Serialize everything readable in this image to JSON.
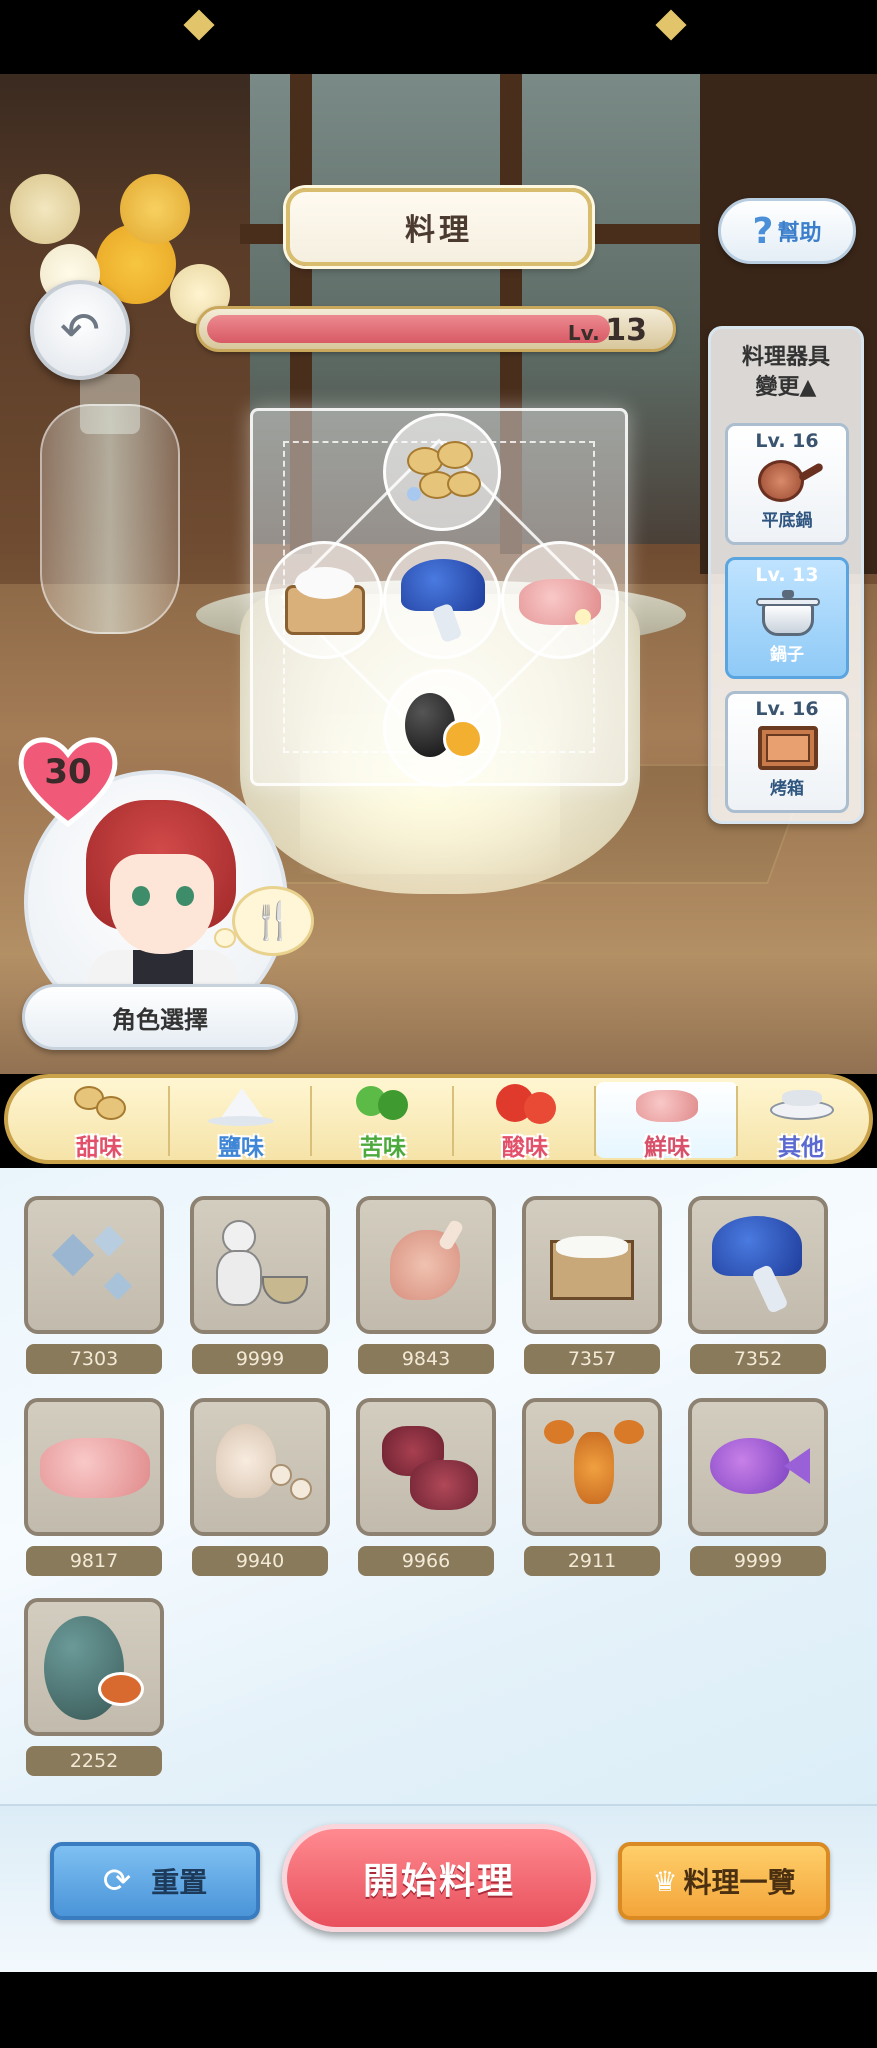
{
  "header": {
    "title": "料理",
    "help_icon": "?",
    "help_label": "幫助"
  },
  "back_icon": "↶",
  "level": {
    "prefix": "Lv.",
    "value": "13",
    "progress": 0.88
  },
  "board": {
    "slots": [
      "sweet-beans",
      "rice",
      "blue-mushroom",
      "pork-meat",
      "black-egg"
    ]
  },
  "tools": {
    "header": "料理器具\n變更▲",
    "items": [
      {
        "level": "Lv. 16",
        "name": "平底鍋",
        "active": false
      },
      {
        "level": "Lv. 13",
        "name": "鍋子",
        "active": true
      },
      {
        "level": "Lv. 16",
        "name": "烤箱",
        "active": false
      }
    ]
  },
  "character": {
    "affection": "30",
    "select_label": "角色選擇",
    "bubble_icon": "🍴"
  },
  "tabs": [
    {
      "label": "甜味",
      "color": "#e2506a"
    },
    {
      "label": "鹽味",
      "color": "#3f86d6"
    },
    {
      "label": "苦味",
      "color": "#4caa3c"
    },
    {
      "label": "酸味",
      "color": "#e2506a"
    },
    {
      "label": "鮮味",
      "color": "#d8506a"
    },
    {
      "label": "其他",
      "color": "#5a6ad0"
    }
  ],
  "inventory": [
    {
      "icon": "ice-crystal",
      "count": "7303"
    },
    {
      "icon": "seasoning-jar",
      "count": "9999"
    },
    {
      "icon": "chicken-leg",
      "count": "9843"
    },
    {
      "icon": "rice-box",
      "count": "7357"
    },
    {
      "icon": "blue-mushroom",
      "count": "7352"
    },
    {
      "icon": "pork-meat",
      "count": "9817"
    },
    {
      "icon": "garlic",
      "count": "9940"
    },
    {
      "icon": "beef",
      "count": "9966"
    },
    {
      "icon": "lobster",
      "count": "2911"
    },
    {
      "icon": "tropical-fish",
      "count": "9999"
    },
    {
      "icon": "spotted-egg",
      "count": "2252"
    }
  ],
  "actions": {
    "reset_icon": "⟳",
    "reset_label": "重置",
    "start_label": "開始料理",
    "list_icon": "♛",
    "list_label": "料理一覽"
  }
}
